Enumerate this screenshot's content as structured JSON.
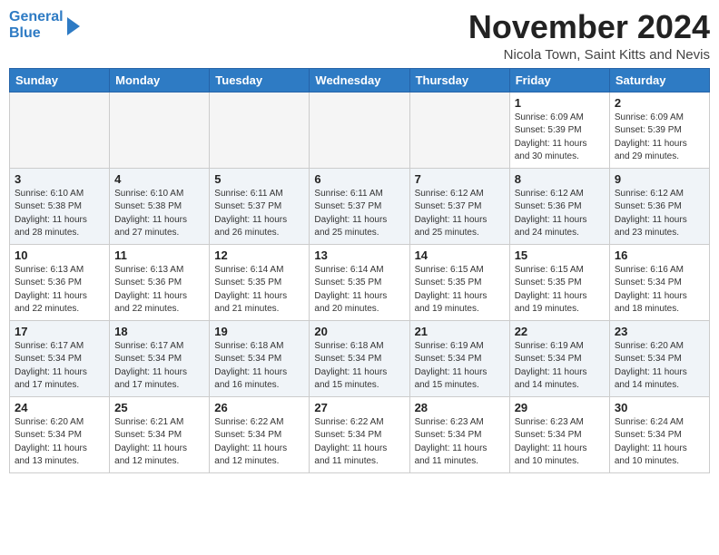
{
  "header": {
    "logo_line1": "General",
    "logo_line2": "Blue",
    "month_title": "November 2024",
    "location": "Nicola Town, Saint Kitts and Nevis"
  },
  "days_of_week": [
    "Sunday",
    "Monday",
    "Tuesday",
    "Wednesday",
    "Thursday",
    "Friday",
    "Saturday"
  ],
  "weeks": [
    [
      {
        "day": "",
        "info": ""
      },
      {
        "day": "",
        "info": ""
      },
      {
        "day": "",
        "info": ""
      },
      {
        "day": "",
        "info": ""
      },
      {
        "day": "",
        "info": ""
      },
      {
        "day": "1",
        "info": "Sunrise: 6:09 AM\nSunset: 5:39 PM\nDaylight: 11 hours\nand 30 minutes."
      },
      {
        "day": "2",
        "info": "Sunrise: 6:09 AM\nSunset: 5:39 PM\nDaylight: 11 hours\nand 29 minutes."
      }
    ],
    [
      {
        "day": "3",
        "info": "Sunrise: 6:10 AM\nSunset: 5:38 PM\nDaylight: 11 hours\nand 28 minutes."
      },
      {
        "day": "4",
        "info": "Sunrise: 6:10 AM\nSunset: 5:38 PM\nDaylight: 11 hours\nand 27 minutes."
      },
      {
        "day": "5",
        "info": "Sunrise: 6:11 AM\nSunset: 5:37 PM\nDaylight: 11 hours\nand 26 minutes."
      },
      {
        "day": "6",
        "info": "Sunrise: 6:11 AM\nSunset: 5:37 PM\nDaylight: 11 hours\nand 25 minutes."
      },
      {
        "day": "7",
        "info": "Sunrise: 6:12 AM\nSunset: 5:37 PM\nDaylight: 11 hours\nand 25 minutes."
      },
      {
        "day": "8",
        "info": "Sunrise: 6:12 AM\nSunset: 5:36 PM\nDaylight: 11 hours\nand 24 minutes."
      },
      {
        "day": "9",
        "info": "Sunrise: 6:12 AM\nSunset: 5:36 PM\nDaylight: 11 hours\nand 23 minutes."
      }
    ],
    [
      {
        "day": "10",
        "info": "Sunrise: 6:13 AM\nSunset: 5:36 PM\nDaylight: 11 hours\nand 22 minutes."
      },
      {
        "day": "11",
        "info": "Sunrise: 6:13 AM\nSunset: 5:36 PM\nDaylight: 11 hours\nand 22 minutes."
      },
      {
        "day": "12",
        "info": "Sunrise: 6:14 AM\nSunset: 5:35 PM\nDaylight: 11 hours\nand 21 minutes."
      },
      {
        "day": "13",
        "info": "Sunrise: 6:14 AM\nSunset: 5:35 PM\nDaylight: 11 hours\nand 20 minutes."
      },
      {
        "day": "14",
        "info": "Sunrise: 6:15 AM\nSunset: 5:35 PM\nDaylight: 11 hours\nand 19 minutes."
      },
      {
        "day": "15",
        "info": "Sunrise: 6:15 AM\nSunset: 5:35 PM\nDaylight: 11 hours\nand 19 minutes."
      },
      {
        "day": "16",
        "info": "Sunrise: 6:16 AM\nSunset: 5:34 PM\nDaylight: 11 hours\nand 18 minutes."
      }
    ],
    [
      {
        "day": "17",
        "info": "Sunrise: 6:17 AM\nSunset: 5:34 PM\nDaylight: 11 hours\nand 17 minutes."
      },
      {
        "day": "18",
        "info": "Sunrise: 6:17 AM\nSunset: 5:34 PM\nDaylight: 11 hours\nand 17 minutes."
      },
      {
        "day": "19",
        "info": "Sunrise: 6:18 AM\nSunset: 5:34 PM\nDaylight: 11 hours\nand 16 minutes."
      },
      {
        "day": "20",
        "info": "Sunrise: 6:18 AM\nSunset: 5:34 PM\nDaylight: 11 hours\nand 15 minutes."
      },
      {
        "day": "21",
        "info": "Sunrise: 6:19 AM\nSunset: 5:34 PM\nDaylight: 11 hours\nand 15 minutes."
      },
      {
        "day": "22",
        "info": "Sunrise: 6:19 AM\nSunset: 5:34 PM\nDaylight: 11 hours\nand 14 minutes."
      },
      {
        "day": "23",
        "info": "Sunrise: 6:20 AM\nSunset: 5:34 PM\nDaylight: 11 hours\nand 14 minutes."
      }
    ],
    [
      {
        "day": "24",
        "info": "Sunrise: 6:20 AM\nSunset: 5:34 PM\nDaylight: 11 hours\nand 13 minutes."
      },
      {
        "day": "25",
        "info": "Sunrise: 6:21 AM\nSunset: 5:34 PM\nDaylight: 11 hours\nand 12 minutes."
      },
      {
        "day": "26",
        "info": "Sunrise: 6:22 AM\nSunset: 5:34 PM\nDaylight: 11 hours\nand 12 minutes."
      },
      {
        "day": "27",
        "info": "Sunrise: 6:22 AM\nSunset: 5:34 PM\nDaylight: 11 hours\nand 11 minutes."
      },
      {
        "day": "28",
        "info": "Sunrise: 6:23 AM\nSunset: 5:34 PM\nDaylight: 11 hours\nand 11 minutes."
      },
      {
        "day": "29",
        "info": "Sunrise: 6:23 AM\nSunset: 5:34 PM\nDaylight: 11 hours\nand 10 minutes."
      },
      {
        "day": "30",
        "info": "Sunrise: 6:24 AM\nSunset: 5:34 PM\nDaylight: 11 hours\nand 10 minutes."
      }
    ]
  ]
}
